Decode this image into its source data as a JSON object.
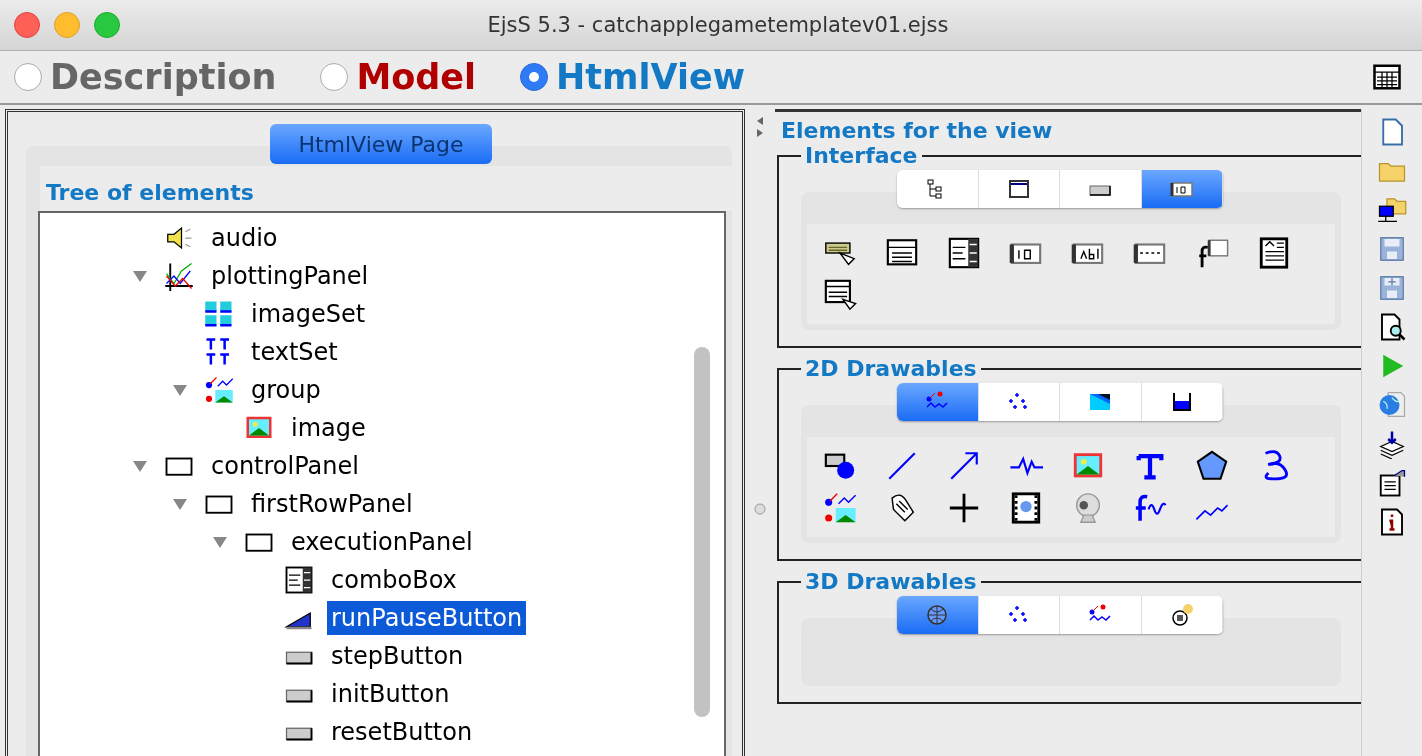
{
  "window": {
    "title": "EjsS 5.3 - catchapplegametemplatev01.ejss"
  },
  "modes": [
    {
      "label": "Description",
      "selected": false,
      "color": "#666666"
    },
    {
      "label": "Model",
      "selected": false,
      "color": "#b00000"
    },
    {
      "label": "HtmlView",
      "selected": true,
      "color": "#1479c4"
    }
  ],
  "page_tab": {
    "label": "HtmlView Page"
  },
  "tree": {
    "title": "Tree of elements",
    "items": [
      {
        "label": "audio",
        "kind": "sound",
        "selected": false
      },
      {
        "label": "plottingPanel",
        "kind": "plot",
        "selected": false,
        "expanded": true,
        "children": [
          {
            "label": "imageSet",
            "kind": "image-set",
            "selected": false
          },
          {
            "label": "textSet",
            "kind": "text-set",
            "selected": false
          },
          {
            "label": "group",
            "kind": "group",
            "selected": false,
            "expanded": true,
            "children": [
              {
                "label": "image",
                "kind": "image",
                "selected": false
              }
            ]
          }
        ]
      },
      {
        "label": "controlPanel",
        "kind": "panel",
        "selected": false,
        "expanded": true,
        "children": [
          {
            "label": "firstRowPanel",
            "kind": "panel",
            "selected": false,
            "expanded": true,
            "children": [
              {
                "label": "executionPanel",
                "kind": "panel",
                "selected": false,
                "expanded": true,
                "children": [
                  {
                    "label": "comboBox",
                    "kind": "combo",
                    "selected": false
                  },
                  {
                    "label": "runPauseButton",
                    "kind": "two-state",
                    "selected": true
                  },
                  {
                    "label": "stepButton",
                    "kind": "button",
                    "selected": false
                  },
                  {
                    "label": "initButton",
                    "kind": "button",
                    "selected": false
                  },
                  {
                    "label": "resetButton",
                    "kind": "button",
                    "selected": false
                  }
                ]
              }
            ]
          }
        ]
      }
    ]
  },
  "palette": {
    "title": "Elements for the view",
    "sections": [
      {
        "title": "Interface",
        "tabs": [
          {
            "selected": false
          },
          {
            "selected": false
          },
          {
            "selected": false
          },
          {
            "selected": true
          }
        ]
      },
      {
        "title": "2D Drawables",
        "tabs": [
          {
            "selected": true
          },
          {
            "selected": false
          },
          {
            "selected": false
          },
          {
            "selected": false
          }
        ]
      },
      {
        "title": "3D Drawables",
        "tabs": [
          {
            "selected": true
          },
          {
            "selected": false
          },
          {
            "selected": false
          },
          {
            "selected": false
          }
        ]
      }
    ]
  }
}
